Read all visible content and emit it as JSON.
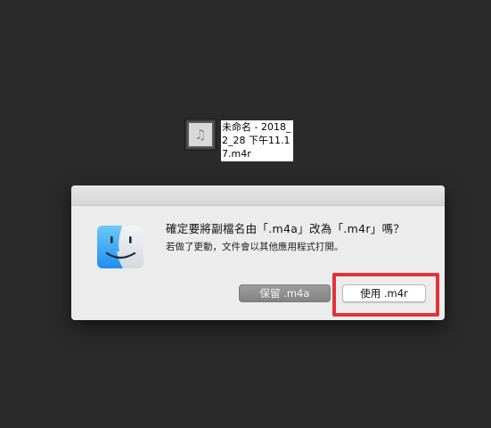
{
  "desktop": {
    "file": {
      "icon": "music-note-icon",
      "glyph": "♫",
      "name": "未命名 - 2018_2_28 下午11.17.m4r"
    }
  },
  "dialog": {
    "icon": "finder-icon",
    "title": "確定要將副檔名由「.m4a」改為「.m4r」嗎？",
    "message": "若做了更動，文件會以其他應用程式打開。",
    "buttons": {
      "keep": "保留 .m4a",
      "use": "使用 .m4r"
    }
  },
  "annotation": {
    "highlight_color": "#e2333a"
  }
}
